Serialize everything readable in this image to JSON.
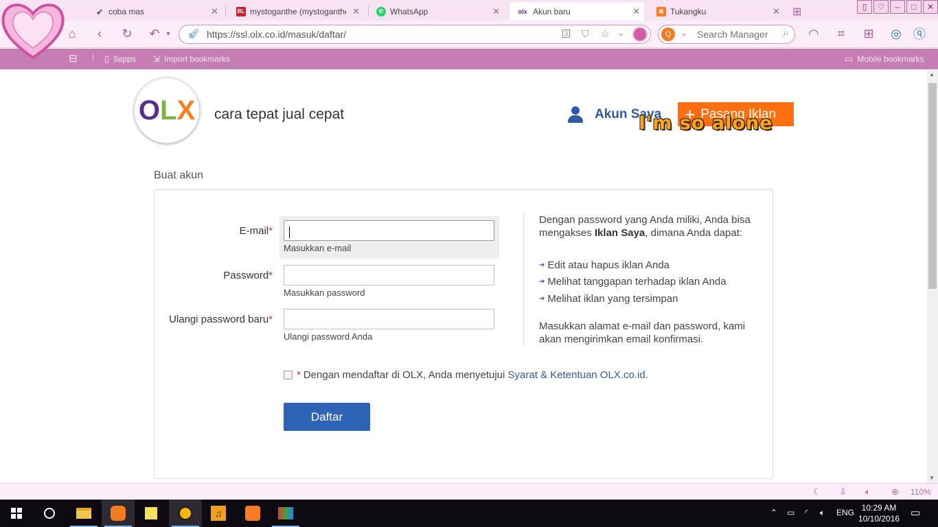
{
  "browser": {
    "tabs": [
      {
        "title": "coba mas",
        "favicon": "bird-icon"
      },
      {
        "title": "mystoganthe (mystoganthe)",
        "favicon": "bukalapak-icon",
        "favicon_text": "BL"
      },
      {
        "title": "WhatsApp",
        "favicon": "whatsapp-icon"
      },
      {
        "title": "Akun baru",
        "favicon": "olx-icon",
        "favicon_text": "olx",
        "active": true
      },
      {
        "title": "Tukangku",
        "favicon": "xampp-icon"
      }
    ],
    "url": "https://ssl.olx.co.id/masuk/daftar/",
    "tab_count_badge": "3",
    "search_placeholder": "Search Manager",
    "bookmarks": {
      "items": [
        {
          "label": "9apps"
        },
        {
          "label": "Import bookmarks"
        }
      ],
      "mobile": "Mobile bookmarks"
    },
    "zoom": "110%"
  },
  "header": {
    "logo": {
      "o": "O",
      "l": "L",
      "x": "X"
    },
    "tagline": "cara tepat jual cepat",
    "akun_saya": "Akun Saya",
    "pasang_iklan": "Pasang Iklan",
    "overlay_text": "I'm so alone"
  },
  "form": {
    "section_title": "Buat akun",
    "required_mark": "*",
    "email": {
      "label": "E-mail",
      "value": "",
      "hint": "Masukkan e-mail"
    },
    "password": {
      "label": "Password",
      "value": "",
      "hint": "Masukkan password"
    },
    "repeat_password": {
      "label": "Ulangi password baru",
      "value": "",
      "hint": "Ulangi password Anda"
    },
    "agree": {
      "text": "Dengan mendaftar di OLX, Anda menyetujui",
      "link": "Syarat & Ketentuan OLX.co.id",
      "suffix": ".",
      "checked": false
    },
    "submit": "Daftar"
  },
  "info": {
    "intro_1": "Dengan password yang Anda miliki, Anda bisa",
    "intro_2_prefix": "mengakses",
    "intro_2_bold": "Iklan Saya",
    "intro_2_suffix": ", dimana Anda dapat:",
    "bullets": [
      "Edit atau hapus iklan Anda",
      "Melihat tanggapan terhadap iklan Anda",
      "Melihat iklan yang tersimpan"
    ],
    "outro_1": "Masukkan alamat e-mail dan password, kami",
    "outro_2": "akan mengirimkan email konfirmasi."
  },
  "taskbar": {
    "language": "ENG",
    "time": "10:29 AM",
    "date": "10/10/2016"
  },
  "colors": {
    "olx_purple": "#5b2c8e",
    "olx_green": "#7cb342",
    "olx_orange": "#f5821f",
    "pasang_orange": "#ff6e0f",
    "link_blue": "#2d5aa8",
    "button_blue": "#2f63b8",
    "bookmark_bar": "#c67db3"
  }
}
